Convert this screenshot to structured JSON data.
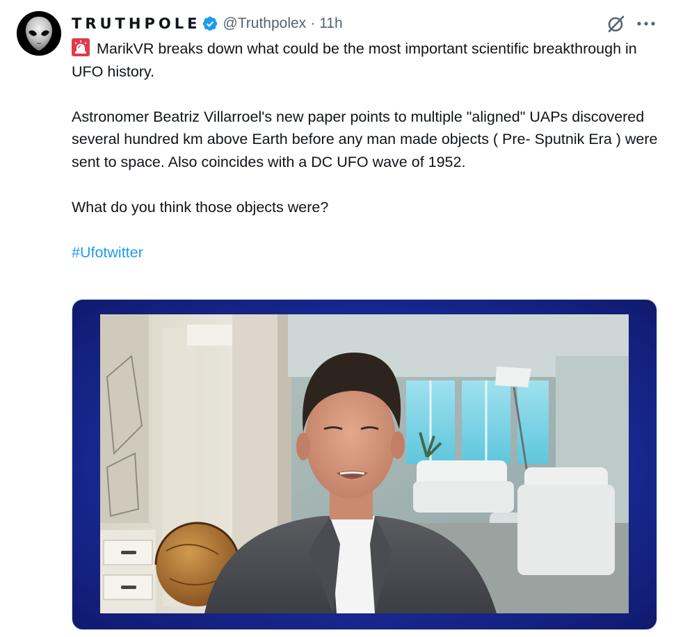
{
  "tweet": {
    "author": {
      "display_name": "TRUTHPOLE",
      "handle": "@Truthpolex",
      "separator": "·",
      "time": "11h",
      "verified": true,
      "avatar_icon": "alien-head-icon"
    },
    "text": {
      "line1": "MarikVR breaks down what could be the most important scientific breakthrough in UFO history.",
      "line2": "Astronomer Beatriz Villarroel's new paper points to multiple \"aligned\" UAPs discovered several hundred km above Earth before any man made objects ( Pre- Sputnik Era ) were sent to space. Also coincides with a DC UFO wave of 1952.",
      "line3": "What do you think those objects were?",
      "hashtag": "#Ufotwitter"
    },
    "icons": {
      "siren": "rotating-light-icon",
      "grok": "grok-icon",
      "more": "more-icon",
      "verified": "verified-badge-icon"
    },
    "colors": {
      "accent": "#1d9bf0",
      "text": "#0f1419",
      "secondary": "#536471",
      "media_frame": "#1a2a96"
    }
  }
}
